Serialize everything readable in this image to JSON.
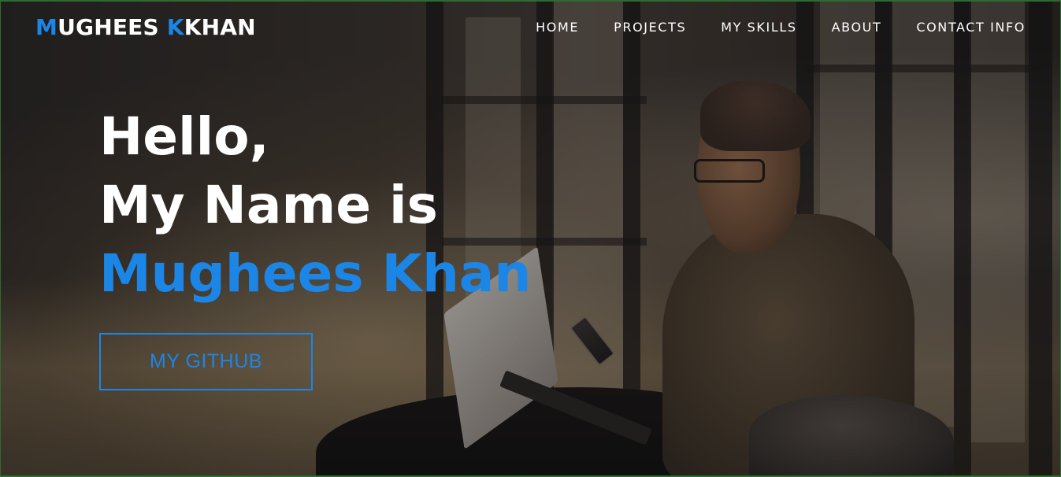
{
  "brand": {
    "first_initial": "M",
    "first_rest": "UGHEES ",
    "second_initial": "K",
    "second_rest": "KHAN"
  },
  "nav": {
    "items": [
      {
        "label": "HOME"
      },
      {
        "label": "PROJECTS"
      },
      {
        "label": "MY SKILLS"
      },
      {
        "label": "ABOUT"
      },
      {
        "label": "CONTACT INFO"
      }
    ]
  },
  "hero": {
    "line1": "Hello,",
    "line2": "My Name is",
    "name": "Mughees Khan",
    "button_label": "MY GITHUB"
  },
  "colors": {
    "accent": "#1b86e6",
    "text": "#ffffff"
  }
}
